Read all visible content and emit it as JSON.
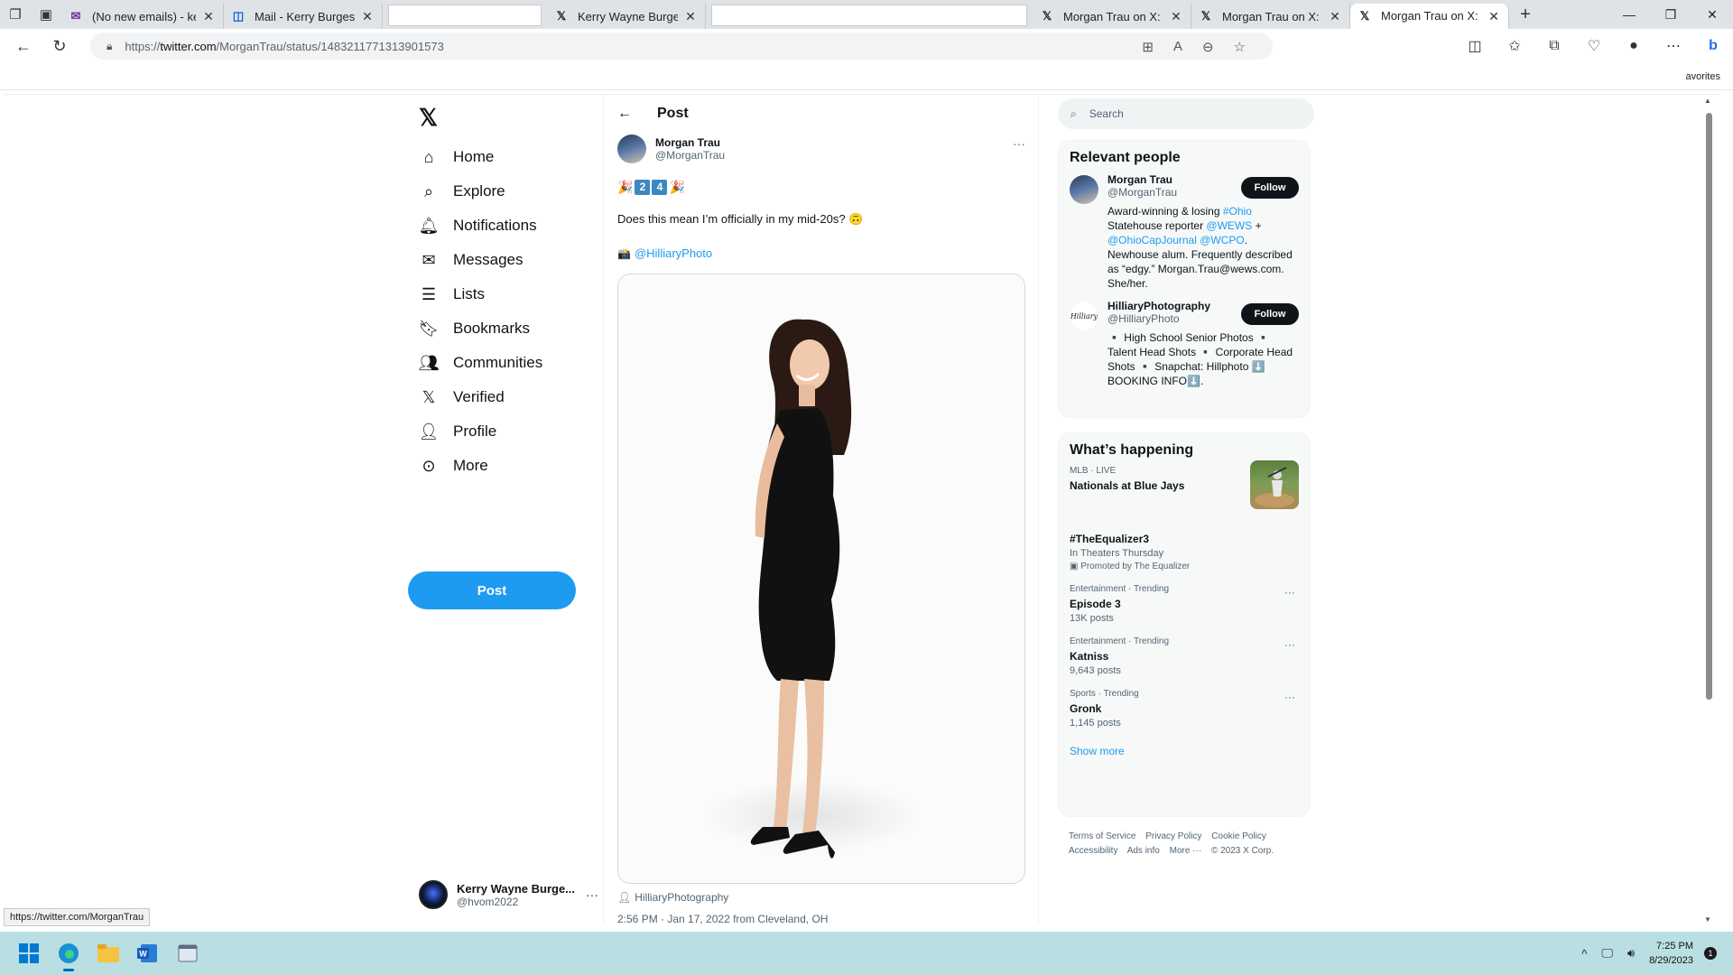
{
  "browser": {
    "tabs": [
      {
        "title": "(No new emails) - ke",
        "icon": "mail-icon"
      },
      {
        "title": "Mail - Kerry Burgess -",
        "icon": "outlook-icon"
      },
      {
        "title": "",
        "icon": "blank"
      },
      {
        "title": "Kerry Wayne Burgess",
        "icon": "x-icon"
      },
      {
        "title": "",
        "icon": "blank"
      },
      {
        "title": "Morgan Trau on X: \"D",
        "icon": "x-icon"
      },
      {
        "title": "Morgan Trau on X: \"S",
        "icon": "x-icon"
      },
      {
        "title": "Morgan Trau on X: \"🎉",
        "icon": "x-icon"
      }
    ],
    "url_prefix": "https://",
    "url_host": "twitter.com",
    "url_path": "/MorganTrau/status/1483211771313901573",
    "favorites_label": "avorites",
    "status_url": "https://twitter.com/MorganTrau"
  },
  "nav": {
    "items": [
      {
        "label": "Home",
        "icon": "home-icon"
      },
      {
        "label": "Explore",
        "icon": "search-icon"
      },
      {
        "label": "Notifications",
        "icon": "bell-icon"
      },
      {
        "label": "Messages",
        "icon": "envelope-icon"
      },
      {
        "label": "Lists",
        "icon": "list-icon"
      },
      {
        "label": "Bookmarks",
        "icon": "bookmark-icon"
      },
      {
        "label": "Communities",
        "icon": "people-icon"
      },
      {
        "label": "Verified",
        "icon": "x-logo-icon"
      },
      {
        "label": "Profile",
        "icon": "person-icon"
      },
      {
        "label": "More",
        "icon": "more-circle-icon"
      }
    ],
    "post_label": "Post",
    "account": {
      "name": "Kerry Wayne Burge...",
      "handle": "@hvom2022"
    }
  },
  "post": {
    "header": "Post",
    "author_name": "Morgan Trau",
    "author_handle": "@MorganTrau",
    "emoji_left": "🎉",
    "emoji_keycap_1": "2",
    "emoji_keycap_2": "4",
    "emoji_right": "🎉",
    "text": "Does this mean I’m officially in my mid-20s? 🙃",
    "credit_icon": "📸",
    "credit_mention": "@HilliaryPhoto",
    "photo_tag": "HilliaryPhotography",
    "timestamp": "2:56 PM · Jan 17, 2022 from Cleveland, OH"
  },
  "sidebar": {
    "search_placeholder": "Search",
    "relevant_title": "Relevant people",
    "people": [
      {
        "name": "Morgan Trau",
        "handle": "@MorganTrau",
        "follow": "Follow",
        "bio_parts": [
          "Award-winning & losing ",
          "#Ohio",
          " Statehouse reporter ",
          "@WEWS",
          " + ",
          "@OhioCapJournal",
          " ",
          "@WCPO",
          ". Newhouse alum. Frequently described as “edgy.” Morgan.Trau@wews.com. She/her."
        ]
      },
      {
        "name": "HilliaryPhotography",
        "handle": "@HilliaryPhoto",
        "follow": "Follow",
        "avatar_text": "Hilliary",
        "bio": "▪️ High School Senior Photos ▪️ Talent Head Shots ▪️ Corporate Head Shots ▪️ Snapchat: Hillphoto ⬇️ BOOKING INFO⬇️."
      }
    ],
    "happening_title": "What’s happening",
    "trends": [
      {
        "meta": "MLB · LIVE",
        "name": "Nationals at Blue Jays"
      },
      {
        "name": "#TheEqualizer3",
        "sub": "In Theaters Thursday",
        "promo": "Promoted by The Equalizer"
      },
      {
        "meta": "Entertainment · Trending",
        "name": "Episode 3",
        "count": "13K posts"
      },
      {
        "meta": "Entertainment · Trending",
        "name": "Katniss",
        "count": "9,643 posts"
      },
      {
        "meta": "Sports · Trending",
        "name": "Gronk",
        "count": "1,145 posts"
      }
    ],
    "show_more": "Show more",
    "footer_links": [
      "Terms of Service",
      "Privacy Policy",
      "Cookie Policy",
      "Accessibility",
      "Ads info",
      "More ···",
      "© 2023 X Corp."
    ]
  },
  "taskbar": {
    "time": "7:25 PM",
    "date": "8/29/2023",
    "notification_count": "1"
  },
  "colors": {
    "accent": "#1d9bf0",
    "text": "#0f1419",
    "muted": "#536471",
    "taskbar": "#b9dfe2"
  }
}
